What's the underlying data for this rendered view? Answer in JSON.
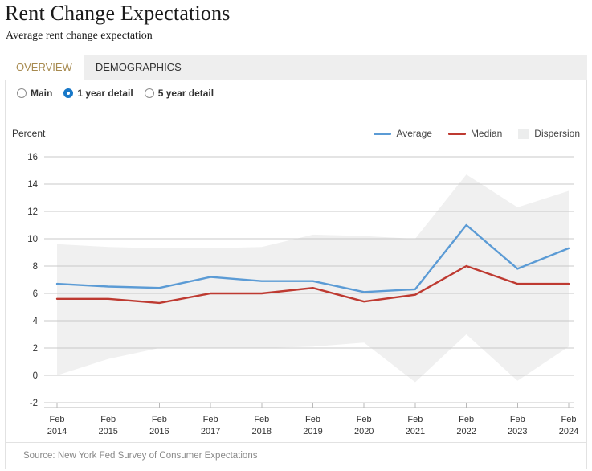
{
  "header": {
    "title": "Rent Change Expectations",
    "subtitle": "Average rent change expectation"
  },
  "tabs": [
    {
      "label": "OVERVIEW",
      "active": true
    },
    {
      "label": "DEMOGRAPHICS",
      "active": false
    }
  ],
  "radios": [
    {
      "label": "Main",
      "selected": false
    },
    {
      "label": "1 year detail",
      "selected": true
    },
    {
      "label": "5 year detail",
      "selected": false
    }
  ],
  "legend": [
    {
      "label": "Average",
      "color": "#5b9bd5",
      "kind": "line"
    },
    {
      "label": "Median",
      "color": "#be3a31",
      "kind": "line"
    },
    {
      "label": "Dispersion",
      "color": "#eceded",
      "kind": "box"
    }
  ],
  "footer": {
    "source": "Source: New York Fed Survey of Consumer Expectations"
  },
  "colors": {
    "average": "#5b9bd5",
    "median": "#be3a31",
    "dispersion": "#f0f0f0",
    "grid": "#c9c9c9",
    "accent_tab": "#a78a4f",
    "radio_selected": "#1878c8"
  },
  "chart_data": {
    "type": "line",
    "title": "Rent Change Expectations",
    "subtitle": "Average rent change expectation",
    "xlabel": "",
    "ylabel": "Percent",
    "ylim": [
      -2,
      16
    ],
    "ytick_step": 2,
    "yticks": [
      -2,
      0,
      2,
      4,
      6,
      8,
      10,
      12,
      14,
      16
    ],
    "grid": true,
    "legend_position": "top-right",
    "categories": [
      "Feb 2014",
      "Feb 2015",
      "Feb 2016",
      "Feb 2017",
      "Feb 2018",
      "Feb 2019",
      "Feb 2020",
      "Feb 2021",
      "Feb 2022",
      "Feb 2023",
      "Feb 2024"
    ],
    "xtick_labels_line1": [
      "Feb",
      "Feb",
      "Feb",
      "Feb",
      "Feb",
      "Feb",
      "Feb",
      "Feb",
      "Feb",
      "Feb",
      "Feb"
    ],
    "xtick_labels_line2": [
      "2014",
      "2015",
      "2016",
      "2017",
      "2018",
      "2019",
      "2020",
      "2021",
      "2022",
      "2023",
      "2024"
    ],
    "series": [
      {
        "name": "Average",
        "color": "#5b9bd5",
        "values": [
          6.7,
          6.5,
          6.4,
          7.2,
          6.9,
          6.9,
          6.1,
          6.3,
          11.0,
          7.8,
          9.3
        ]
      },
      {
        "name": "Median",
        "color": "#be3a31",
        "values": [
          5.6,
          5.6,
          5.3,
          6.0,
          6.0,
          6.4,
          5.4,
          5.9,
          8.0,
          6.7,
          6.7
        ]
      }
    ],
    "band": {
      "name": "Dispersion",
      "color": "#f0f0f0",
      "upper": [
        9.6,
        9.4,
        9.3,
        9.3,
        9.4,
        10.3,
        10.2,
        10.0,
        14.7,
        12.3,
        13.5
      ],
      "lower": [
        0.0,
        1.2,
        2.0,
        2.0,
        2.0,
        2.1,
        2.4,
        -0.5,
        3.0,
        -0.4,
        2.1
      ]
    }
  }
}
